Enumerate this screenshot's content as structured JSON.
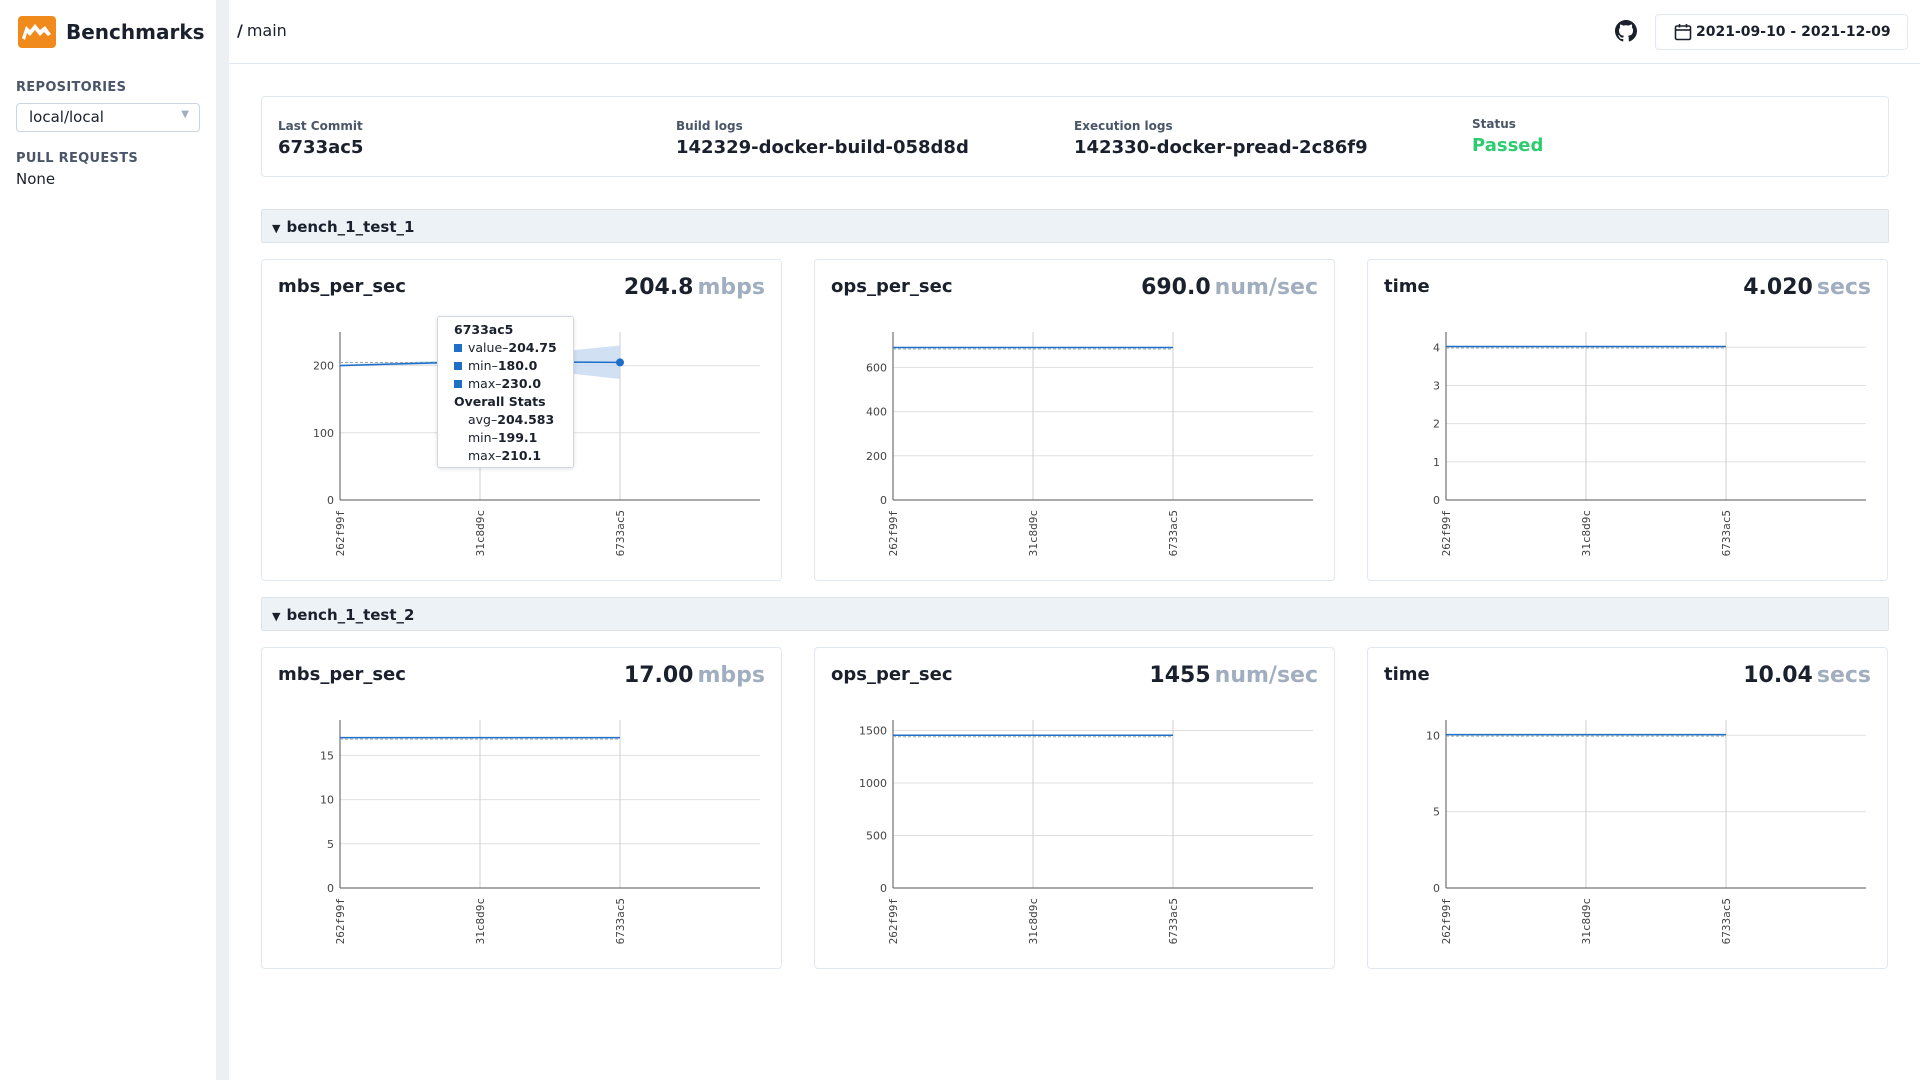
{
  "brand": {
    "title": "Benchmarks"
  },
  "sidebar": {
    "repositories_label": "REPOSITORIES",
    "repo_selected": "local/local",
    "pull_requests_label": "PULL REQUESTS",
    "pull_requests_value": "None"
  },
  "header": {
    "breadcrumb_sep": "/",
    "breadcrumb": "main",
    "date_range": "2021-09-10 - 2021-12-09"
  },
  "summary": {
    "last_commit_label": "Last Commit",
    "last_commit": "6733ac5",
    "build_logs_label": "Build logs",
    "build_logs": "142329-docker-build-058d8d",
    "exec_logs_label": "Execution logs",
    "exec_logs": "142330-docker-pread-2c86f9",
    "status_label": "Status",
    "status": "Passed"
  },
  "groups": [
    {
      "name": "bench_1_test_1"
    },
    {
      "name": "bench_1_test_2"
    }
  ],
  "tooltip": {
    "commit": "6733ac5",
    "value_label": "value–",
    "value": "204.75",
    "min_label": "min–",
    "min": "180.0",
    "max_label": "max–",
    "max": "230.0",
    "overall_label": "Overall Stats",
    "avg_label": "avg–",
    "avg": "204.583",
    "omin_label": "min–",
    "omin": "199.1",
    "omax_label": "max–",
    "omax": "210.1"
  },
  "colors": {
    "line": "#1f6fc7",
    "band": "#c6daf0",
    "grid": "#e0e0e0",
    "passed": "#2ecc71"
  },
  "chart_data": [
    {
      "type": "line",
      "group": "bench_1_test_1",
      "title": "mbs_per_sec",
      "latest": "204.8",
      "unit": "mbps",
      "x": [
        "262f99f",
        "31c8d9c",
        "6733ac5"
      ],
      "y": [
        200,
        206,
        204.75
      ],
      "band_min": [
        199,
        203,
        180
      ],
      "band_max": [
        202,
        209,
        230
      ],
      "yticks": [
        0,
        100,
        200
      ],
      "ylim": [
        0,
        250
      ]
    },
    {
      "type": "line",
      "group": "bench_1_test_1",
      "title": "ops_per_sec",
      "latest": "690.0",
      "unit": "num/sec",
      "x": [
        "262f99f",
        "31c8d9c",
        "6733ac5"
      ],
      "y": [
        690,
        690,
        690
      ],
      "yticks": [
        0,
        200,
        400,
        600
      ],
      "ylim": [
        0,
        760
      ]
    },
    {
      "type": "line",
      "group": "bench_1_test_1",
      "title": "time",
      "latest": "4.020",
      "unit": "secs",
      "x": [
        "262f99f",
        "31c8d9c",
        "6733ac5"
      ],
      "y": [
        4.02,
        4.02,
        4.02
      ],
      "yticks": [
        0,
        1,
        2,
        3,
        4
      ],
      "ylim": [
        0,
        4.4
      ]
    },
    {
      "type": "line",
      "group": "bench_1_test_2",
      "title": "mbs_per_sec",
      "latest": "17.00",
      "unit": "mbps",
      "x": [
        "262f99f",
        "31c8d9c",
        "6733ac5"
      ],
      "y": [
        17,
        17,
        17
      ],
      "yticks": [
        0,
        5,
        10,
        15
      ],
      "ylim": [
        0,
        19
      ]
    },
    {
      "type": "line",
      "group": "bench_1_test_2",
      "title": "ops_per_sec",
      "latest": "1455",
      "unit": "num/sec",
      "x": [
        "262f99f",
        "31c8d9c",
        "6733ac5"
      ],
      "y": [
        1455,
        1455,
        1455
      ],
      "yticks": [
        0,
        500,
        1000,
        1500
      ],
      "ylim": [
        0,
        1600
      ]
    },
    {
      "type": "line",
      "group": "bench_1_test_2",
      "title": "time",
      "latest": "10.04",
      "unit": "secs",
      "x": [
        "262f99f",
        "31c8d9c",
        "6733ac5"
      ],
      "y": [
        10.04,
        10.04,
        10.04
      ],
      "yticks": [
        0,
        5,
        10
      ],
      "ylim": [
        0,
        11
      ]
    }
  ]
}
